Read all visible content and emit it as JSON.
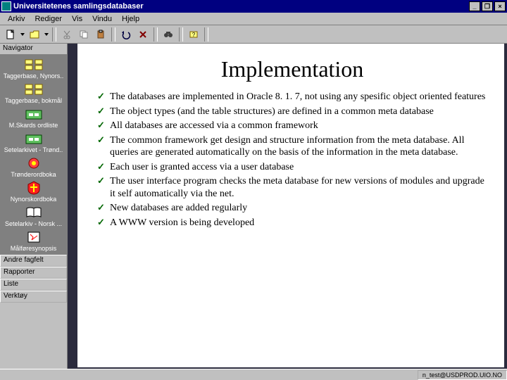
{
  "window": {
    "title": "Universitetenes samlingsdatabaser",
    "min_label": "_",
    "max_label": "❐",
    "close_label": "×"
  },
  "menu": [
    "Arkiv",
    "Rediger",
    "Vis",
    "Vindu",
    "Hjelp"
  ],
  "toolbar": {
    "buttons": [
      "new",
      "dropdown",
      "open",
      "sep",
      "cut",
      "copy",
      "paste",
      "sep",
      "undo",
      "delete",
      "sep",
      "find",
      "sep",
      "help",
      "sep"
    ]
  },
  "sidebar": {
    "header": "Navigator",
    "items": [
      {
        "label": "Taggerbase, Nynors..",
        "icon": "db"
      },
      {
        "label": "Taggerbase, bokmål",
        "icon": "db"
      },
      {
        "label": "M.Skards ordliste",
        "icon": "folder"
      },
      {
        "label": "Setelarkivet - Trønd..",
        "icon": "folder"
      },
      {
        "label": "Trønderordboka",
        "icon": "rose"
      },
      {
        "label": "Nynorskordboka",
        "icon": "crest"
      },
      {
        "label": "Setelarkiv - Norsk ...",
        "icon": "book"
      },
      {
        "label": "Målføresynopsis",
        "icon": "small"
      }
    ],
    "footer": [
      "Andre fagfelt",
      "Rapporter",
      "Liste",
      "Verktøy"
    ]
  },
  "slide": {
    "title": "Implementation",
    "bullets": [
      "The databases are implemented in Oracle 8. 1. 7, not using any spesific object oriented features",
      "The object types (and the table structures) are defined in a common meta database",
      "All databases are accessed via a common framework",
      "The common framework get design and structure information from the meta database. All queries are generated automatically on the basis of the information in the meta database.",
      "Each user is granted access via a user database",
      "The user interface program checks the meta database for new versions of modules and upgrade it self automatically via the net.",
      "New databases are added regularly",
      "A WWW version is being developed"
    ]
  },
  "taskbar": {
    "tray": "n_test@USDPROD.UIO.NO"
  }
}
